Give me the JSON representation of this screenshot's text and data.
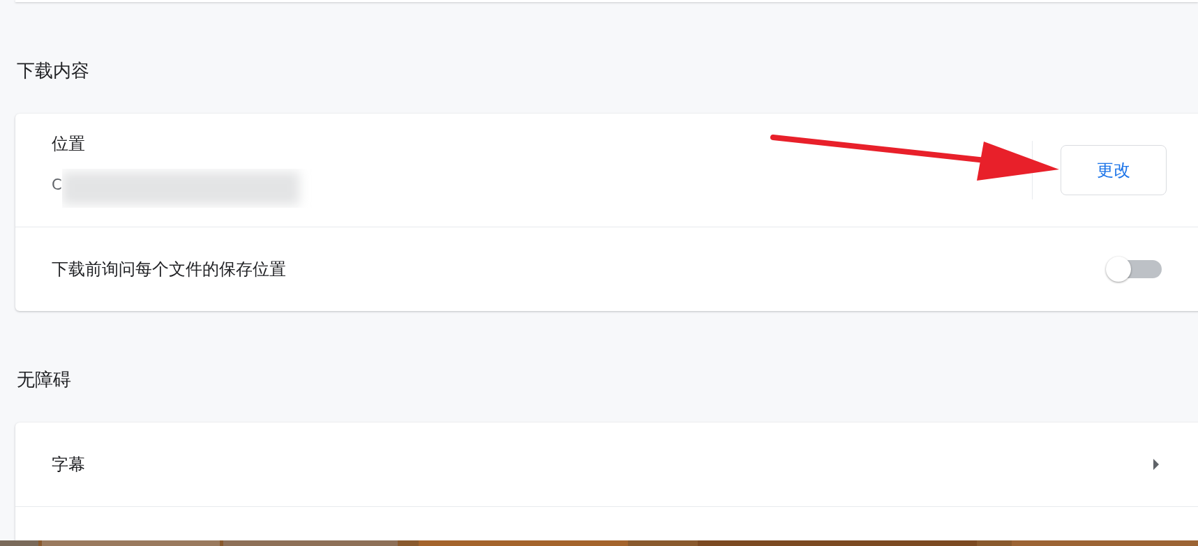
{
  "sections": [
    {
      "title": "下载内容",
      "rows": [
        {
          "kind": "location",
          "label": "位置",
          "value": "C",
          "button": "更改"
        },
        {
          "kind": "toggle",
          "label": "下载前询问每个文件的保存位置",
          "on": false
        }
      ]
    },
    {
      "title": "无障碍",
      "rows": [
        {
          "kind": "link",
          "label": "字幕"
        },
        {
          "kind": "blank"
        }
      ]
    }
  ]
}
